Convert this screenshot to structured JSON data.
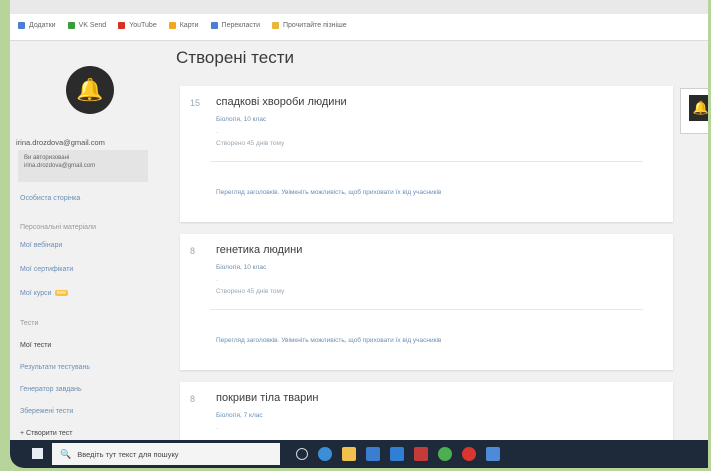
{
  "bookmarks": [
    {
      "label": "Додатки",
      "color": "#4a7fd4"
    },
    {
      "label": "VK Send",
      "color": "#3b9c3b"
    },
    {
      "label": "YouTube",
      "color": "#d93025"
    },
    {
      "label": "Карти",
      "color": "#f2a81d"
    },
    {
      "label": "Перекласти",
      "color": "#4a7fd4"
    },
    {
      "label": "Прочитайте пізніше",
      "color": "#e8b73a"
    }
  ],
  "page": {
    "title": "Створені тести"
  },
  "sidebar": {
    "email": "irina.drozdova@gmail.com",
    "auth_line1": "Ви авторизовані",
    "auth_line2": "irina.drozdova@gmail.com",
    "profile_settings": "Особиста сторінка",
    "section_materials": "Персональні матеріали",
    "my_webinars": "Мої вебінари",
    "my_certificates": "Мої сертифікати",
    "my_courses": "Мої курси",
    "new_badge": "new",
    "section_tests": "Тести",
    "all_tests": "Мої тести",
    "test_results": "Результати тестувань",
    "item_generator": "Генератор завдань",
    "item_saved": "Збережені тести",
    "item_create": "+ Створити тест"
  },
  "tests": [
    {
      "num": "15",
      "title": "спадкові хвороби людини",
      "meta": "Біологія, 10 клас",
      "dot": "·",
      "created": "Створено 45 днів тому",
      "footer": "Перегляд заголовків. Увімкніть можливість, щоб приховати їх від учасників"
    },
    {
      "num": "8",
      "title": "генетика людини",
      "meta": "Біологія, 10 клас",
      "dot": "·",
      "created": "Створено 45 днів тому",
      "footer": "Перегляд заголовків. Увімкніть можливість, щоб приховати їх від учасників"
    },
    {
      "num": "8",
      "title": "покриви тіла тварин",
      "meta": "Біологія, 7 клас",
      "dot": "·",
      "created": "",
      "footer": ""
    }
  ],
  "taskbar": {
    "search_placeholder": "Введіть тут текст для пошуку",
    "icons": [
      "task-view-icon",
      "edge-icon",
      "file-explorer-icon",
      "store-icon",
      "mail-icon",
      "antivirus-icon",
      "chrome-icon",
      "opera-icon",
      "app-icon"
    ]
  },
  "colors": {
    "accent": "#6b8fb3",
    "avatar_bg": "#2b2b2b",
    "bell": "#f2a81d",
    "taskbar": "#1e2a3a"
  }
}
